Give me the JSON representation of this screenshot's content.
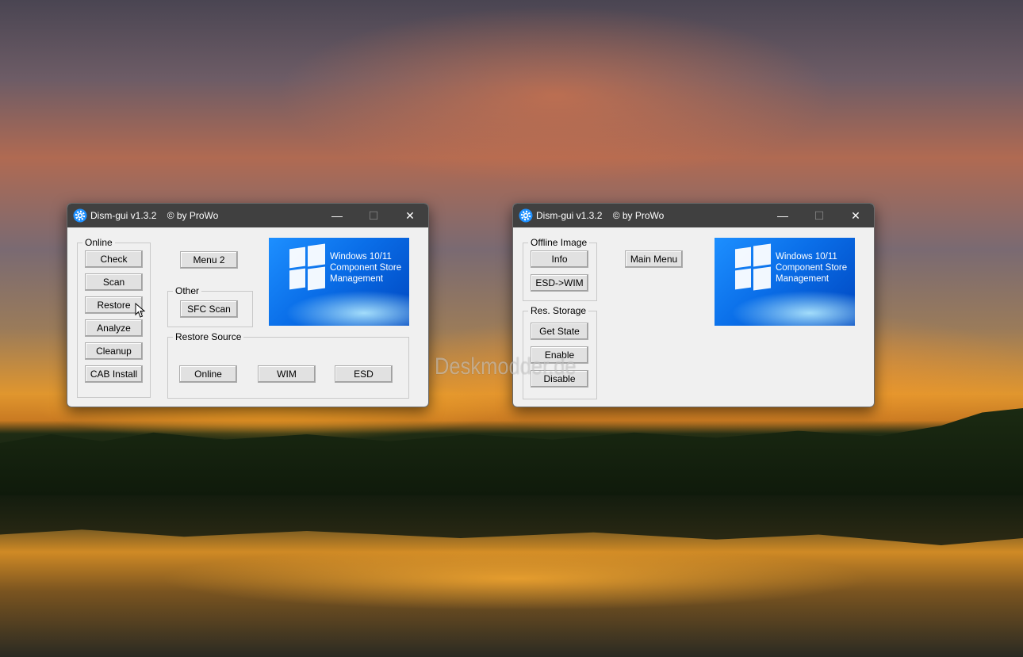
{
  "windows": [
    {
      "title": "Dism-gui v1.3.2    © by ProWo",
      "online_group": "Online",
      "buttons": [
        "Check",
        "Scan",
        "Restore",
        "Analyze",
        "Cleanup",
        "CAB Install"
      ],
      "menu_button": "Menu 2",
      "other_group": "Other",
      "sfc_button": "SFC Scan",
      "restore_source_group": "Restore Source",
      "source_buttons": [
        "Online",
        "WIM",
        "ESD"
      ],
      "banner": [
        "Windows 10/11",
        "Component Store",
        "Management"
      ]
    },
    {
      "title": "Dism-gui v1.3.2    © by ProWo",
      "offline_group": "Offline Image",
      "offline_buttons": [
        "Info",
        "ESD->WIM"
      ],
      "storage_group": "Res. Storage",
      "storage_buttons": [
        "Get State",
        "Enable",
        "Disable"
      ],
      "menu_button": "Main Menu",
      "banner": [
        "Windows 10/11",
        "Component Store",
        "Management"
      ]
    }
  ],
  "window_controls": {
    "minimize": "—",
    "maximize": "☐",
    "close": "✕"
  },
  "watermark": "Deskmodder.de",
  "icons": {
    "app": "gear-icon",
    "logo": "windows-logo-icon",
    "pointer": "mouse-cursor-icon"
  }
}
